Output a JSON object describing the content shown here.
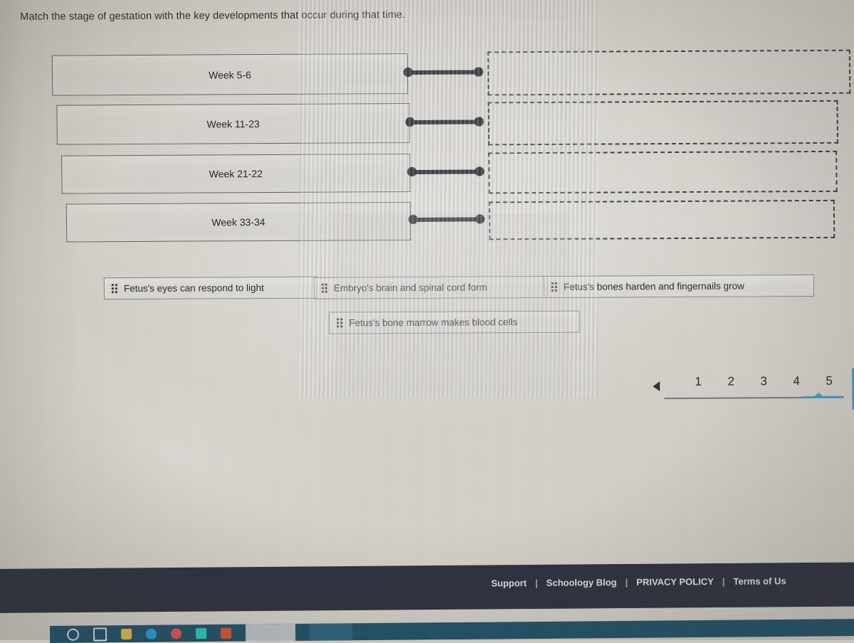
{
  "question": {
    "prompt": "Match the stage of gestation with the key developments that occur during that time."
  },
  "match_rows": [
    {
      "term": "Week 5-6",
      "answer": ""
    },
    {
      "term": "Week 11-23",
      "answer": ""
    },
    {
      "term": "Week 21-22",
      "answer": ""
    },
    {
      "term": "Week 33-34",
      "answer": ""
    }
  ],
  "answer_bank": [
    {
      "label": "Fetus's eyes can respond to light",
      "handle_icon": "drag-grip-icon"
    },
    {
      "label": "Embryo's brain and spinal cord form",
      "handle_icon": "drag-grip-icon"
    },
    {
      "label": "Fetus's bones harden and fingernails grow",
      "handle_icon": "drag-grip-icon"
    },
    {
      "label": "Fetus's bone marrow makes blood cells",
      "handle_icon": "drag-grip-icon"
    }
  ],
  "pagination": {
    "prev_icon": "triangle-left-icon",
    "pages": [
      "1",
      "2",
      "3",
      "4",
      "5"
    ],
    "active_page": "5",
    "accent_color": "#3f93c0"
  },
  "footer": {
    "links": [
      "Support",
      "Schoology Blog",
      "PRIVACY POLICY",
      "Terms of Us"
    ],
    "separator": "|",
    "background_color": "#2c2f3c"
  },
  "taskbar": {
    "icons": [
      "search-icon",
      "task-view-icon",
      "file-explorer-icon",
      "browser-icon",
      "app-red-icon",
      "app-teal-icon",
      "app-orange-icon"
    ],
    "background_color": "#1f4d63"
  },
  "theme": {
    "page_background": "#cdcac2",
    "box_border": "#5d5d5f",
    "dropzone_border": "#3a3c42",
    "connector_color": "#23252b",
    "text_color": "#232325"
  }
}
